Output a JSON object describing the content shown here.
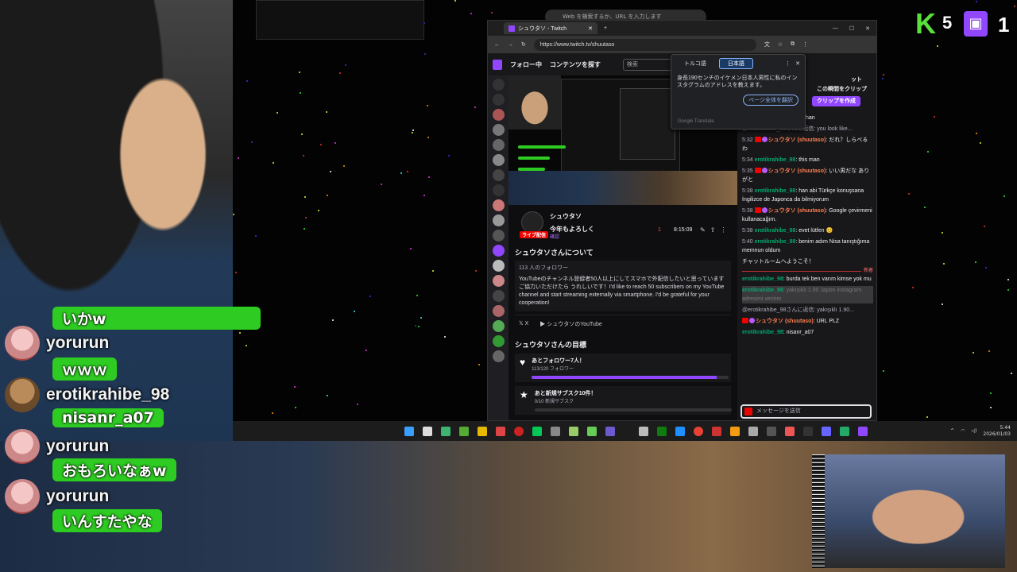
{
  "overlay": {
    "kick_count": "5",
    "twitch_count": "1",
    "chat": [
      {
        "user": "",
        "text": "いかw"
      },
      {
        "user": "yorurun",
        "text": "ｗｗｗ"
      },
      {
        "user": "erotikrahibe_98",
        "text": "nisanr_a07"
      },
      {
        "user": "yorurun",
        "text": "おもろいなぁw"
      },
      {
        "user": "yorurun",
        "text": "いんすたやな"
      }
    ]
  },
  "browser": {
    "float_omnibox": "Web を検索するか、URL を入力します",
    "tab_title": "シュウタソ - Twitch",
    "url": "https://www.twitch.tv/shuutaso",
    "nav": {
      "following": "フォロー中",
      "browse": "コンテンツを探す",
      "search_placeholder": "検索"
    },
    "translate": {
      "lang_from": "トルコ語",
      "lang_to": "日本語",
      "message": "身長190センチのイケメン日本人男性に私のインスタグラムのアドレスを教えます。",
      "button": "ページ全体を翻訳",
      "footer": "Google Translate"
    },
    "stream": {
      "channel": "シュウタソ",
      "title": "今年もよろしく",
      "live_label": "ライブ配信",
      "verified_label": "確認",
      "viewers": "1",
      "uptime": "8:15:09",
      "about_heading": "シュウタソさんについて",
      "followers": "113 人のフォロワー",
      "about_text": "YouTubeのチャンネル登録者50人以上にしてスマホで外配信したいと思っていますご協力いただけたら うれしいです！I'd like to reach 50 subscribers on my YouTube channel and start streaming externally via smartphone. I'd be grateful for your cooperation!",
      "social_x": "X",
      "social_youtube": "シュウタソのYouTube",
      "goals_heading": "シュウタソさんの目標",
      "goals": [
        {
          "title": "あとフォロワー7人！",
          "sub": "113/120 フォロワー",
          "progress": 0.94
        },
        {
          "title": "あと新規サブスク10件！",
          "sub": "0/10 新規サブスク",
          "progress": 0.0
        }
      ]
    },
    "chat": {
      "header_suffix": "ット",
      "clip_text": "この瞬間をクリップ",
      "clip_button": "クリップを作成",
      "input_placeholder": "メッセージを送信",
      "new_label": "新着",
      "messages": [
        {
          "time": "",
          "user": "",
          "text": "you look like a Tokyo drift han"
        },
        {
          "reply": "@erotikrahibe_98さんに返信: you look like..."
        },
        {
          "time": "5:32",
          "user": "シュウタソ (shuutaso)",
          "text": ": だれ？しらべるわ",
          "kind": "streamer"
        },
        {
          "time": "5:34",
          "user": "erotikrahibe_98",
          "text": ": this man",
          "kind": "viewer"
        },
        {
          "time": "5:35",
          "user": "シュウタソ (shuutaso)",
          "text": ": いい男だな ありがと",
          "kind": "streamer"
        },
        {
          "time": "5:38",
          "user": "erotikrahibe_98",
          "text": ": han abi Türkçe konuşsana İngilizce de Japonca da bilmiyorum",
          "kind": "viewer"
        },
        {
          "time": "5:38",
          "user": "シュウタソ (shuutaso)",
          "text": ": Google çevirmeni kullanacağım.",
          "kind": "streamer"
        },
        {
          "time": "5:38",
          "user": "erotikrahibe_98",
          "text": ": evet lütfen 😊",
          "kind": "viewer"
        },
        {
          "time": "5:40",
          "user": "erotikrahibe_98",
          "text": ": benim adım Nisa tanıştığıma memnun oldum",
          "kind": "viewer"
        },
        {
          "system": "チャットルームへようこそ！"
        },
        {
          "time": "",
          "user": "erotikrahibe_98",
          "text": ": burda tek ben varım kimse yok mu",
          "kind": "viewer"
        },
        {
          "time": "",
          "user": "erotikrahibe_98",
          "text": ": yakışıklı 1.90 Japon instagram adresimi veririm",
          "kind": "highlight"
        },
        {
          "reply": "@erotikrahibe_98さんに返信: yakışıklı 1.90..."
        },
        {
          "time": "",
          "user": "シュウタソ (shuutaso)",
          "text": ": URL PLZ",
          "kind": "streamer"
        },
        {
          "time": "",
          "user": "erotikrahibe_98",
          "text": ": nisanr_a07",
          "kind": "viewer"
        }
      ]
    }
  },
  "taskbar": {
    "time": "5:44",
    "date": "2026/01/03"
  }
}
